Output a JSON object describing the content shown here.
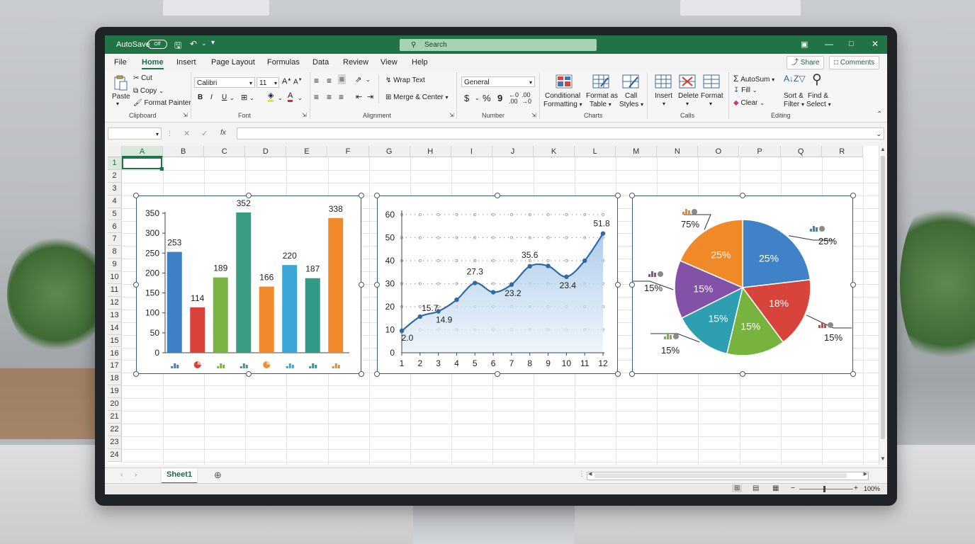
{
  "titlebar": {
    "autosave_label": "AutoSave",
    "autosave_state": "Off",
    "search_placeholder": "Search"
  },
  "menu": {
    "items": [
      "File",
      "Home",
      "Insert",
      "Page Layout",
      "Formulas",
      "Data",
      "Review",
      "View",
      "Help"
    ],
    "active": "Home",
    "share_label": "Share",
    "comments_label": "Comments"
  },
  "ribbon": {
    "clipboard": {
      "paste": "Paste",
      "cut": "Cut",
      "copy": "Copy",
      "format_painter": "Format Painter",
      "label": "Clipboard"
    },
    "font": {
      "name": "Calibri",
      "size": "11",
      "label": "Font",
      "bold": "B",
      "italic": "I",
      "underline": "U",
      "grow": "A",
      "shrink": "A"
    },
    "alignment": {
      "wrap_text": "Wrap Text",
      "merge_center": "Merge & Center",
      "label": "Alignment"
    },
    "number": {
      "format": "General",
      "currency": "$",
      "percent": "%",
      "comma": "9",
      "label": "Number"
    },
    "charts": {
      "conditional_1": "Conditional",
      "conditional_2": "Formatting",
      "format_table_1": "Format as",
      "format_table_2": "Table",
      "cell_styles_1": "Call",
      "cell_styles_2": "Styles",
      "label": "Charts"
    },
    "cells": {
      "insert": "Insert",
      "delete": "Delete",
      "format": "Format",
      "label": "Calls"
    },
    "editing": {
      "autosum": "AutoSum",
      "fill": "Fill",
      "clear": "Clear",
      "sort_1": "Sort &",
      "sort_2": "Filter",
      "find_1": "Find &",
      "find_2": "Select",
      "label": "Editing"
    }
  },
  "formula_bar": {
    "fx": "fx"
  },
  "grid": {
    "columns": [
      "A",
      "B",
      "C",
      "D",
      "E",
      "F",
      "G",
      "H",
      "I",
      "J",
      "K",
      "L",
      "M",
      "N",
      "O",
      "P",
      "Q",
      "R"
    ],
    "rows": [
      "1",
      "2",
      "3",
      "4",
      "5",
      "6",
      "7",
      "8",
      "9",
      "10",
      "11",
      "12",
      "13",
      "14",
      "15",
      "16",
      "17",
      "18",
      "19",
      "20",
      "21",
      "22",
      "23",
      "24"
    ]
  },
  "sheets": {
    "active": "Sheet1"
  },
  "status": {
    "zoom": "100%"
  },
  "colors": {
    "excel_green": "#217346",
    "chart_border": "#2f5c8a"
  },
  "chart_data": [
    {
      "type": "bar",
      "values": [
        253,
        114,
        189,
        352,
        166,
        220,
        187,
        338
      ],
      "data_labels": [
        "253",
        "114",
        "189",
        "352",
        "166",
        "220",
        "187",
        "338"
      ],
      "colors": [
        "#3f7fc6",
        "#d9413b",
        "#79b341",
        "#3a9c82",
        "#f08a2a",
        "#3aa6d6",
        "#2f9a85",
        "#f18a2a"
      ],
      "yticks": [
        "0",
        "50",
        "100",
        "150",
        "200",
        "250",
        "300",
        "350"
      ],
      "ylim": [
        0,
        350
      ],
      "grid": false
    },
    {
      "type": "area",
      "x": [
        1,
        2,
        3,
        4,
        5,
        6,
        7,
        8,
        9,
        10,
        11,
        12
      ],
      "values": [
        9.5,
        15.7,
        18,
        23,
        30.3,
        26.3,
        29.6,
        37.6,
        37.7,
        33,
        40,
        51.8
      ],
      "data_labels": [
        {
          "i": 0,
          "text": "2.0"
        },
        {
          "i": 1,
          "text": "15.7"
        },
        {
          "i": 2,
          "text": "14.9"
        },
        {
          "i": 4,
          "text": "27.3"
        },
        {
          "i": 6,
          "text": "23.2"
        },
        {
          "i": 7,
          "text": "35.6"
        },
        {
          "i": 9,
          "text": "23.4"
        },
        {
          "i": 11,
          "text": "51.8"
        }
      ],
      "xticks": [
        "1",
        "2",
        "3",
        "4",
        "5",
        "6",
        "7",
        "8",
        "9",
        "10",
        "11",
        "12"
      ],
      "yticks": [
        "0",
        "10",
        "20",
        "30",
        "40",
        "50",
        "60"
      ],
      "ylim": [
        0,
        60
      ],
      "grid": true
    },
    {
      "type": "pie",
      "slices": [
        {
          "label": "25%",
          "value": 25,
          "color": "#3f82c8"
        },
        {
          "label": "18%",
          "value": 18,
          "color": "#d8433c"
        },
        {
          "label": "15%",
          "value": 15,
          "color": "#78b33e"
        },
        {
          "label": "15%",
          "value": 15,
          "color": "#2d9fb0"
        },
        {
          "label": "15%",
          "value": 15,
          "color": "#8451a8"
        },
        {
          "label": "25%",
          "value": 20,
          "color": "#f08a28"
        }
      ],
      "callouts": [
        "25%",
        "15%",
        "15%",
        "15%",
        "75%"
      ]
    }
  ]
}
